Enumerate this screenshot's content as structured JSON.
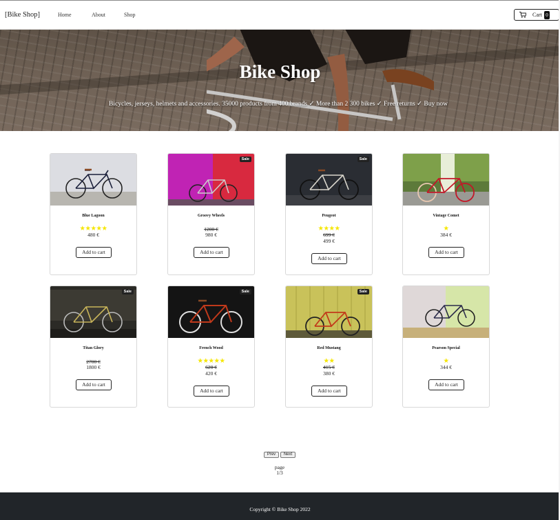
{
  "nav": {
    "brand": "[Bike Shop]",
    "links": [
      "Home",
      "About",
      "Shop"
    ],
    "cart_label": "Cart",
    "cart_count": "0"
  },
  "hero": {
    "title": "Bike Shop",
    "subtitle": "Bicycles, jerseys, helmets and accessories. 35000 products from 400 brands ✓ More than 2 300 bikes ✓ Free returns ✓ Buy now"
  },
  "products": [
    {
      "name": "Blue Lagoon",
      "stars": "★★★★★",
      "old_price": "",
      "price": "480 €",
      "sale": "",
      "add_label": "Add to cart"
    },
    {
      "name": "Groovy Wheels",
      "stars": "",
      "old_price": "1200 €",
      "price": "980 €",
      "sale": "Sale",
      "add_label": "Add to cart"
    },
    {
      "name": "Peugeot",
      "stars": "★★★★",
      "old_price": "699 €",
      "price": "499 €",
      "sale": "Sale",
      "add_label": "Add to cart"
    },
    {
      "name": "Vintage Comet",
      "stars": "★",
      "old_price": "",
      "price": "384 €",
      "sale": "",
      "add_label": "Add to cart"
    },
    {
      "name": "Titan Glory",
      "stars": "",
      "old_price": "2700 €",
      "price": "1800 €",
      "sale": "Sale",
      "add_label": "Add to cart"
    },
    {
      "name": "French Wood",
      "stars": "★★★★★",
      "old_price": "620 €",
      "price": "420 €",
      "sale": "Sale",
      "add_label": "Add to cart"
    },
    {
      "name": "Red Mustang",
      "stars": "★★",
      "old_price": "415 €",
      "price": "380 €",
      "sale": "Sale",
      "add_label": "Add to cart"
    },
    {
      "name": "Pearson Special",
      "stars": "★",
      "old_price": "",
      "price": "344 €",
      "sale": "",
      "add_label": "Add to cart"
    }
  ],
  "pagination": {
    "prev": "Prev",
    "next": "Next",
    "page_label": "page",
    "page_value": "1/3"
  },
  "footer": {
    "copyright": "Copyright © Bike Shop 2022"
  },
  "colors": {
    "star": "#f5e600",
    "footer_bg": "#212529",
    "sale_badge": "#222222"
  }
}
